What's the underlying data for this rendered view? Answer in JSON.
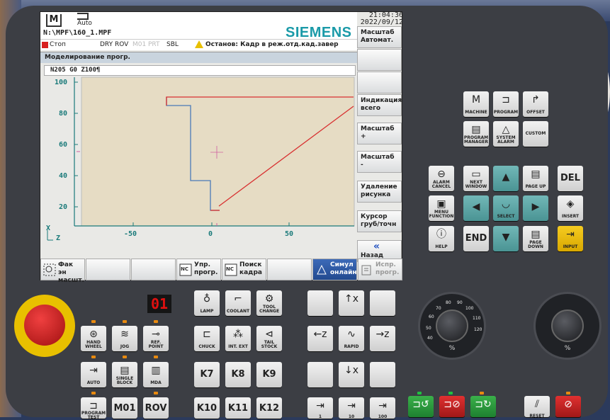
{
  "header": {
    "mode": "Auto",
    "program_path": "N:\\MPF\\160_1.MPF",
    "time": "21:04:36",
    "date": "2022/09/12",
    "brand": "SIEMENS",
    "brand_color": "#1a9aa8"
  },
  "status": {
    "stop": "Стоп",
    "dry_rov": "DRY ROV",
    "m01": "M01",
    "prt": "PRT",
    "sbl": "SBL",
    "message": "Останов: Кадр в реж.отд.кад.завер"
  },
  "window_title": "Моделирование прогр.",
  "nc_line": "N205 G0 Z100¶",
  "plot": {
    "y_ticks": [
      "100",
      "80",
      "60",
      "40",
      "20"
    ],
    "x_ticks": [
      "-50",
      "0",
      "50"
    ],
    "x_axis": "Z",
    "y_axis": "X"
  },
  "vertical_softkeys": [
    "Масштаб Автомат.",
    "",
    "",
    "Индикация всего",
    "Масштаб +",
    "Масштаб -",
    "Удаление рисунка",
    "Курсор груб/точн",
    "Назад"
  ],
  "horizontal_softkeys": [
    "Фак эн масшт.",
    "",
    "",
    "Упр. прогр.",
    "Поиск кадра",
    "",
    "Симул онлайн",
    "Испр. прогр."
  ],
  "keys": {
    "machine": "MACHINE",
    "program": "PROGRAM",
    "offset": "OFFSET",
    "program_manager": "PROGRAM MANAGER",
    "system_alarm": "SYSTEM ALARM",
    "custom": "CUSTOM",
    "alarm_cancel": "ALARM CANCEL",
    "next_window": "NEXT WINDOW",
    "page_up": "PAGE UP",
    "del": "DEL",
    "menu_function": "MENU FUNCTION",
    "select": "SELECT",
    "insert": "INSERT",
    "help": "HELP",
    "end": "END",
    "page_down": "PAGE DOWN",
    "input": "INPUT",
    "lamp": "LAMP",
    "coolant": "COOLANT",
    "tool_change": "TOOL CHANGE",
    "hand_wheel": "HAND WHEEL",
    "jog": "JOG",
    "ref_point": "REF. POINT",
    "chuck": "CHUCK",
    "int_ext": "INT. EXT",
    "tail_stock": "TAIL STOCK",
    "auto": "AUTO",
    "single_block": "SINGLE BLOCK",
    "mda": "MDA",
    "k7": "K7",
    "k8": "K8",
    "k9": "K9",
    "program_test": "PROGRAM TEST",
    "m01": "M01",
    "rov": "ROV",
    "k10": "K10",
    "k11": "K11",
    "k12": "K12",
    "rapid": "RAPID",
    "step1": "1",
    "step10": "10",
    "step100": "100",
    "seg_display": "01",
    "reset": "RESET"
  },
  "dials": {
    "feed_ticks": [
      "40",
      "50",
      "60",
      "70",
      "80",
      "90",
      "100",
      "110",
      "120"
    ],
    "feed_unit": "%",
    "spindle_unit": "%"
  }
}
